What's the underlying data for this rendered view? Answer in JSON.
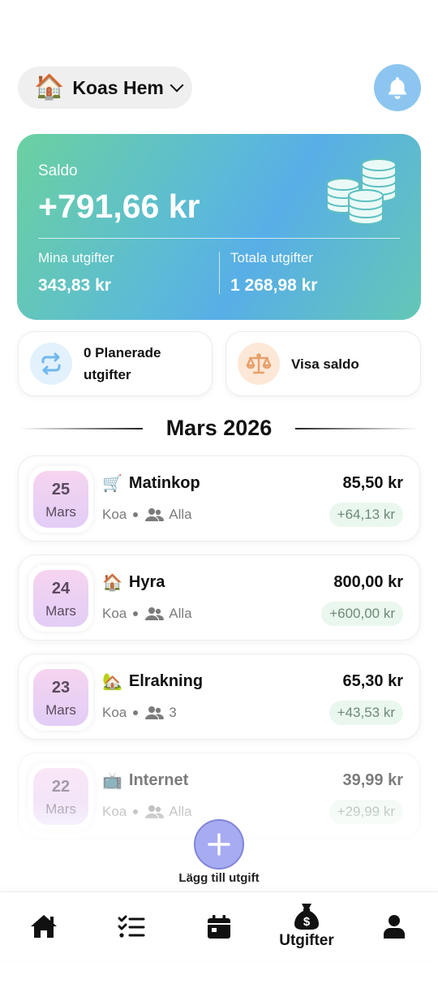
{
  "header": {
    "household_emoji": "🏠",
    "household_name": "Koas Hem"
  },
  "balance": {
    "label": "Saldo",
    "value": "+791,66 kr",
    "my_expenses_label": "Mina utgifter",
    "my_expenses_value": "343,83 kr",
    "total_expenses_label": "Totala utgifter",
    "total_expenses_value": "1 268,98 kr"
  },
  "actions": {
    "planned_label_line1": "0 Planerade",
    "planned_label_line2": "utgifter",
    "show_balance_label": "Visa saldo"
  },
  "month_title": "Mars 2026",
  "expenses": [
    {
      "day": "25",
      "month": "Mars",
      "emoji": "🛒",
      "title": "Matinkop",
      "payer": "Koa",
      "participants": "Alla",
      "amount": "85,50 kr",
      "share": "+64,13 kr"
    },
    {
      "day": "24",
      "month": "Mars",
      "emoji": "🏠",
      "title": "Hyra",
      "payer": "Koa",
      "participants": "Alla",
      "amount": "800,00 kr",
      "share": "+600,00 kr"
    },
    {
      "day": "23",
      "month": "Mars",
      "emoji": "🏡",
      "title": "Elrakning",
      "payer": "Koa",
      "participants": "3",
      "amount": "65,30 kr",
      "share": "+43,53 kr"
    },
    {
      "day": "22",
      "month": "Mars",
      "emoji": "📺",
      "title": "Internet",
      "payer": "Koa",
      "participants": "Alla",
      "amount": "39,99 kr",
      "share": "+29,99 kr"
    }
  ],
  "fab_label": "Lägg till utgift",
  "nav": {
    "active_label": "Utgifter"
  },
  "colors": {
    "accent_blue": "#8cc6f0",
    "fab": "#a7abf1",
    "share_bg": "#eaf7ee"
  }
}
